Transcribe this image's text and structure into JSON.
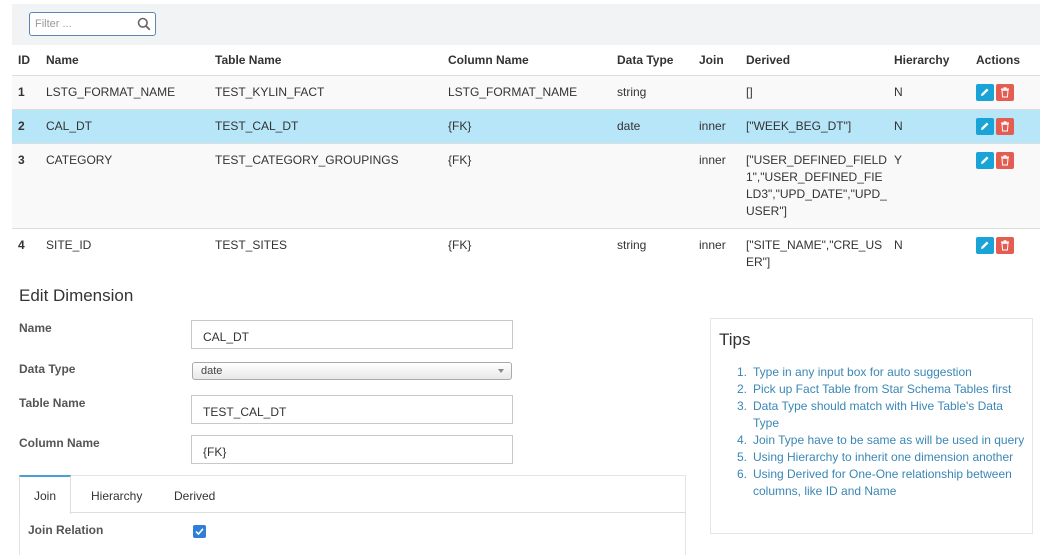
{
  "filter": {
    "placeholder": "Filter ..."
  },
  "table": {
    "headers": [
      "ID",
      "Name",
      "Table Name",
      "Column Name",
      "Data Type",
      "Join",
      "Derived",
      "Hierarchy",
      "Actions"
    ],
    "rows": [
      {
        "id": "1",
        "name": "LSTG_FORMAT_NAME",
        "table": "TEST_KYLIN_FACT",
        "column": "LSTG_FORMAT_NAME",
        "type": "string",
        "join": "",
        "derived": "[]",
        "hierarchy": "N"
      },
      {
        "id": "2",
        "name": "CAL_DT",
        "table": "TEST_CAL_DT",
        "column": "{FK}",
        "type": "date",
        "join": "inner",
        "derived": "[\"WEEK_BEG_DT\"]",
        "hierarchy": "N"
      },
      {
        "id": "3",
        "name": "CATEGORY",
        "table": "TEST_CATEGORY_GROUPINGS",
        "column": "{FK}",
        "type": "",
        "join": "inner",
        "derived": "[\"USER_DEFINED_FIELD1\",\"USER_DEFINED_FIELD3\",\"UPD_DATE\",\"UPD_USER\"]",
        "hierarchy": "Y"
      },
      {
        "id": "4",
        "name": "SITE_ID",
        "table": "TEST_SITES",
        "column": "{FK}",
        "type": "string",
        "join": "inner",
        "derived": "[\"SITE_NAME\",\"CRE_USER\"]",
        "hierarchy": "N"
      }
    ],
    "selected_row": 1
  },
  "edit": {
    "title": "Edit Dimension",
    "name_label": "Name",
    "name_value": "CAL_DT",
    "type_label": "Data Type",
    "type_value": "date",
    "table_label": "Table Name",
    "table_value": "TEST_CAL_DT",
    "column_label": "Column Name",
    "column_value": "{FK}",
    "tabs": [
      "Join",
      "Hierarchy",
      "Derived"
    ],
    "active_tab": "Join",
    "join_relation_label": "Join Relation",
    "join_relation_checked": true
  },
  "tips": {
    "title": "Tips",
    "items": [
      "Type in any input box for auto suggestion",
      "Pick up Fact Table from Star Schema Tables first",
      "Data Type should match with Hive Table's Data Type",
      "Join Type have to be same as will be used in query",
      "Using Hierarchy to inherit one dimension another",
      "Using Derived for One-One relationship between columns, like ID and Name"
    ]
  },
  "colors": {
    "accent": "#1aa3d6",
    "danger": "#e45d52",
    "selected_row": "#b7e6f8",
    "tips_link": "#3a87b5"
  },
  "icons": {
    "search": "search-icon",
    "edit": "pencil-icon",
    "delete": "trash-icon",
    "check": "check-icon"
  }
}
